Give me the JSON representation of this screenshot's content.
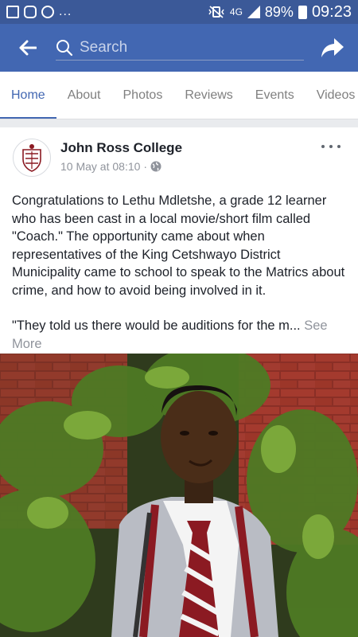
{
  "status_bar": {
    "network": "4G",
    "battery": "89%",
    "time": "09:23",
    "notification_overflow": "..."
  },
  "app_bar": {
    "search_placeholder": "Search"
  },
  "tabs": [
    {
      "label": "Home",
      "active": true
    },
    {
      "label": "About",
      "active": false
    },
    {
      "label": "Photos",
      "active": false
    },
    {
      "label": "Reviews",
      "active": false
    },
    {
      "label": "Events",
      "active": false
    },
    {
      "label": "Videos",
      "active": false
    }
  ],
  "post": {
    "page_name": "John Ross College",
    "timestamp": "10 May at 08:10",
    "separator": "·",
    "privacy_icon": "globe-icon",
    "paragraph1": "Congratulations to Lethu Mdletshe, a grade 12 learner who has been cast in a local movie/short film called \"Coach.\"  The opportunity came about when representatives of the King Cetshwayo District Municipality came to school to speak to the Matrics about crime, and how to avoid being involved in it.",
    "paragraph2": "\"They told us there would be auditions for the m... ",
    "see_more": "See More"
  },
  "colors": {
    "brand_dark": "#3b5998",
    "brand": "#4267b2",
    "tie_red": "#8b1a22"
  }
}
